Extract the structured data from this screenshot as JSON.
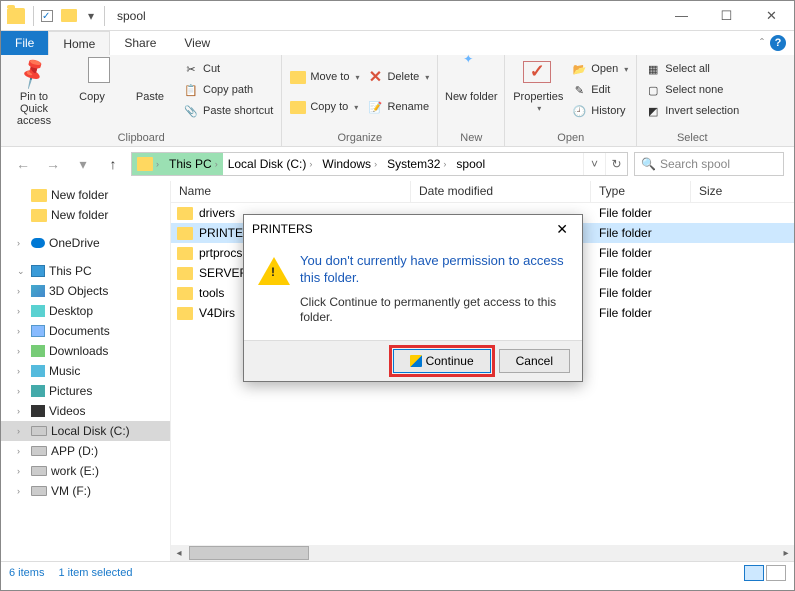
{
  "title": "spool",
  "tabs": {
    "file": "File",
    "home": "Home",
    "share": "Share",
    "view": "View"
  },
  "ribbon": {
    "clipboard": {
      "label": "Clipboard",
      "pin": "Pin to Quick access",
      "copy": "Copy",
      "paste": "Paste",
      "cut": "Cut",
      "copypath": "Copy path",
      "pastesc": "Paste shortcut"
    },
    "organize": {
      "label": "Organize",
      "moveto": "Move to",
      "copyto": "Copy to",
      "delete": "Delete",
      "rename": "Rename"
    },
    "new_": {
      "label": "New",
      "newfolder": "New folder"
    },
    "open": {
      "label": "Open",
      "properties": "Properties",
      "open": "Open",
      "edit": "Edit",
      "history": "History"
    },
    "select": {
      "label": "Select",
      "all": "Select all",
      "none": "Select none",
      "invert": "Invert selection"
    }
  },
  "breadcrumb": [
    "This PC",
    "Local Disk (C:)",
    "Windows",
    "System32",
    "spool"
  ],
  "search_placeholder": "Search spool",
  "tree": {
    "items": [
      {
        "label": "New folder",
        "icon": "folder"
      },
      {
        "label": "New folder",
        "icon": "folder"
      },
      {
        "label": "",
        "spacer": true
      },
      {
        "label": "OneDrive",
        "icon": "onedrive",
        "tw": ">"
      },
      {
        "label": "",
        "spacer": true
      },
      {
        "label": "This PC",
        "icon": "pc",
        "tw": "v"
      },
      {
        "label": "3D Objects",
        "icon": "3d",
        "tw": ">"
      },
      {
        "label": "Desktop",
        "icon": "desk",
        "tw": ">"
      },
      {
        "label": "Documents",
        "icon": "doc",
        "tw": ">"
      },
      {
        "label": "Downloads",
        "icon": "dl",
        "tw": ">"
      },
      {
        "label": "Music",
        "icon": "music",
        "tw": ">"
      },
      {
        "label": "Pictures",
        "icon": "img",
        "tw": ">"
      },
      {
        "label": "Videos",
        "icon": "vid",
        "tw": ">"
      },
      {
        "label": "Local Disk (C:)",
        "icon": "drive",
        "tw": ">",
        "sel": true
      },
      {
        "label": "APP (D:)",
        "icon": "drive",
        "tw": ">"
      },
      {
        "label": "work (E:)",
        "icon": "drive",
        "tw": ">"
      },
      {
        "label": "VM (F:)",
        "icon": "drive",
        "tw": ">"
      }
    ]
  },
  "columns": {
    "name": "Name",
    "date": "Date modified",
    "type": "Type",
    "size": "Size"
  },
  "rows": [
    {
      "name": "drivers",
      "type": "File folder"
    },
    {
      "name": "PRINTERS",
      "type": "File folder",
      "sel": true
    },
    {
      "name": "prtprocs",
      "type": "File folder"
    },
    {
      "name": "SERVERS",
      "type": "File folder"
    },
    {
      "name": "tools",
      "type": "File folder"
    },
    {
      "name": "V4Dirs",
      "type": "File folder"
    }
  ],
  "status": {
    "count": "6 items",
    "sel": "1 item selected"
  },
  "dialog": {
    "title": "PRINTERS",
    "main": "You don't currently have permission to access this folder.",
    "sub": "Click Continue to permanently get access to this folder.",
    "continue": "Continue",
    "cancel": "Cancel"
  }
}
